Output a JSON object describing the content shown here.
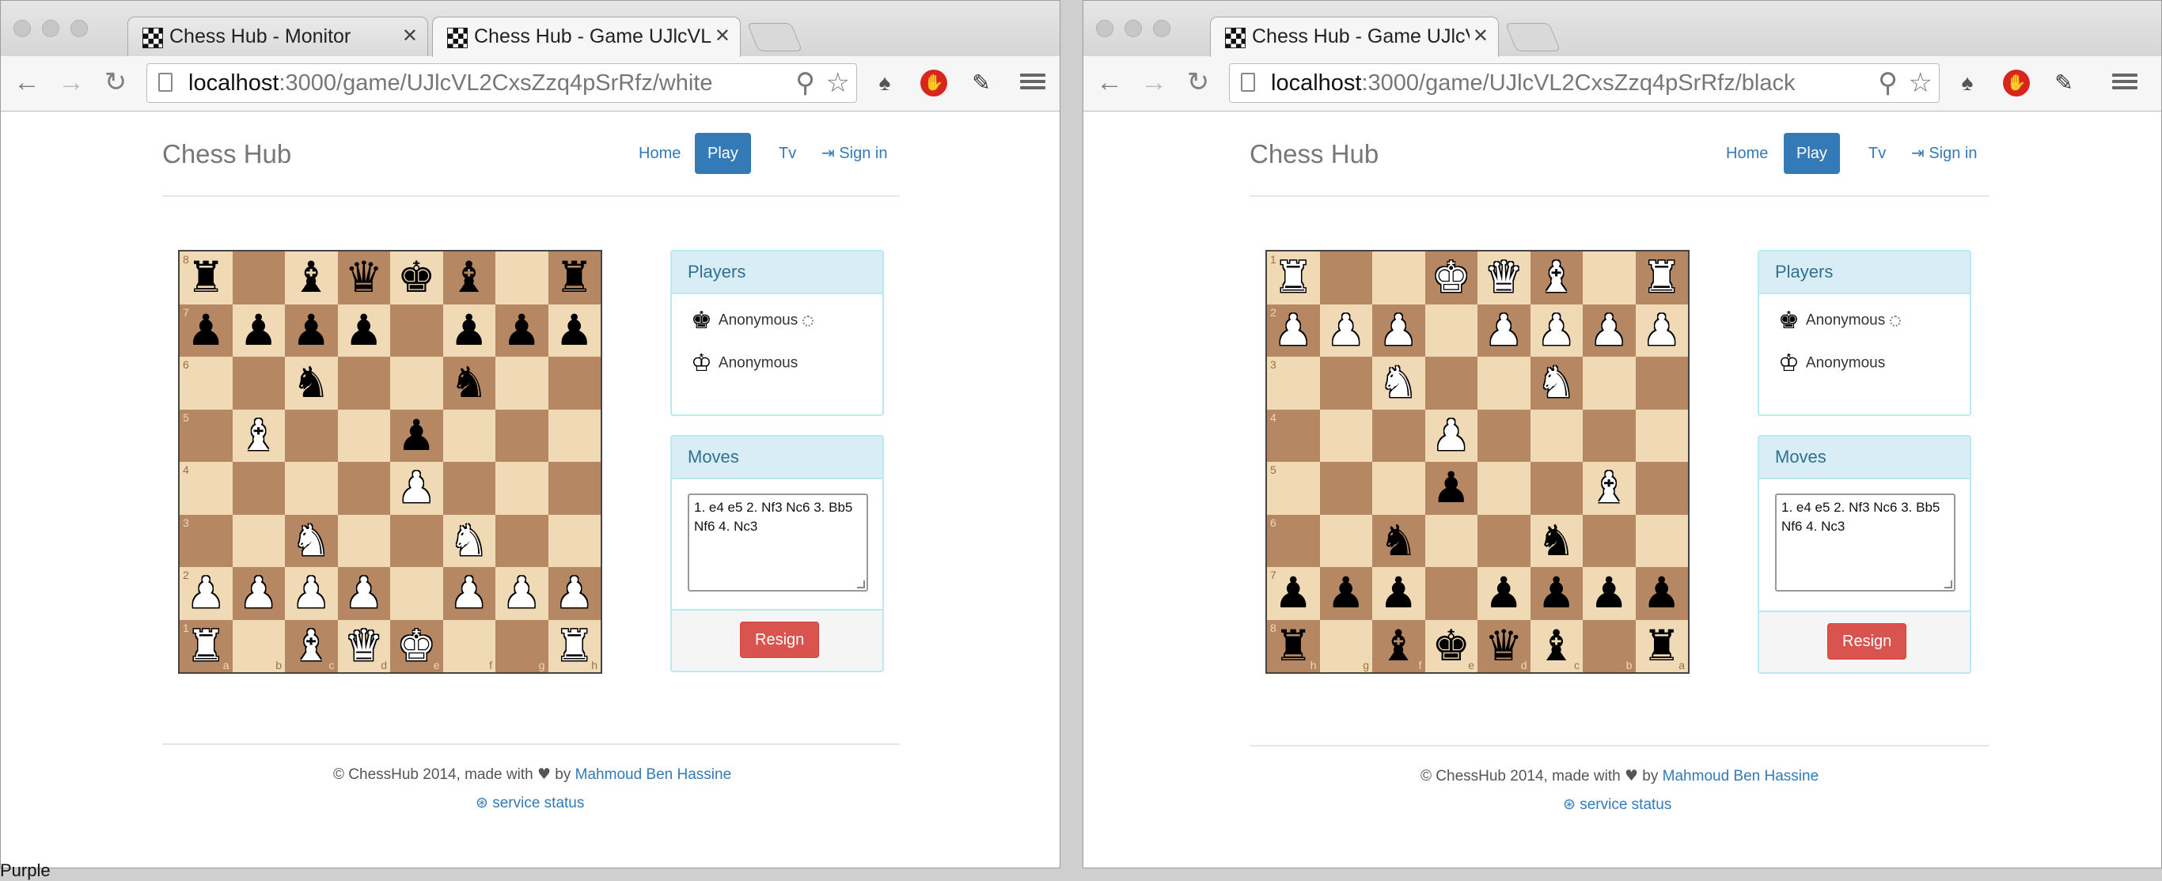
{
  "windows": [
    {
      "tabs": [
        {
          "title": "Chess Hub - Monitor",
          "active": false
        },
        {
          "title": "Chess Hub - Game UJlcVL",
          "active": true
        }
      ],
      "url": {
        "host": "localhost",
        "path": ":3000/game/UJlcVL2CxsZzq4pSrRfz/white"
      },
      "nav": {
        "brand": "Chess Hub",
        "home": "Home",
        "play": "Play",
        "tv": "Tv",
        "signin": "Sign in"
      },
      "orientation": "white",
      "players_title": "Players",
      "players": [
        {
          "name": "Anonymous",
          "piece": "black-king",
          "thinking": true
        },
        {
          "name": "Anonymous",
          "piece": "white-king",
          "thinking": false
        }
      ],
      "moves_title": "Moves",
      "moves_text": "1. e4 e5 2. Nf3 Nc6 3. Bb5 Nf6 4. Nc3",
      "resign_label": "Resign",
      "footer": {
        "copyright": "© ChessHub 2014, made with",
        "by": "by",
        "author": "Mahmoud Ben Hassine",
        "status": "service status"
      }
    },
    {
      "tabs": [
        {
          "title": "Chess Hub - Game UJlcVL",
          "active": true
        }
      ],
      "url": {
        "host": "localhost",
        "path": ":3000/game/UJlcVL2CxsZzq4pSrRfz/black"
      },
      "nav": {
        "brand": "Chess Hub",
        "home": "Home",
        "play": "Play",
        "tv": "Tv",
        "signin": "Sign in"
      },
      "orientation": "black",
      "players_title": "Players",
      "players": [
        {
          "name": "Anonymous",
          "piece": "black-king",
          "thinking": true
        },
        {
          "name": "Anonymous",
          "piece": "white-king",
          "thinking": false
        }
      ],
      "moves_title": "Moves",
      "moves_text": "1. e4 e5 2. Nf3 Nc6 3. Bb5 Nf6 4. Nc3",
      "resign_label": "Resign",
      "footer": {
        "copyright": "© ChessHub 2014, made with",
        "by": "by",
        "author": "Mahmoud Ben Hassine",
        "status": "service status"
      }
    }
  ],
  "position": [
    "r.bqkb.r",
    "pppp.ppp",
    "..n..n..",
    ".B..p...",
    "....P...",
    "..N..N..",
    "PPPP.PPP",
    "R.BQK..R"
  ],
  "desktop_text": "Purple"
}
